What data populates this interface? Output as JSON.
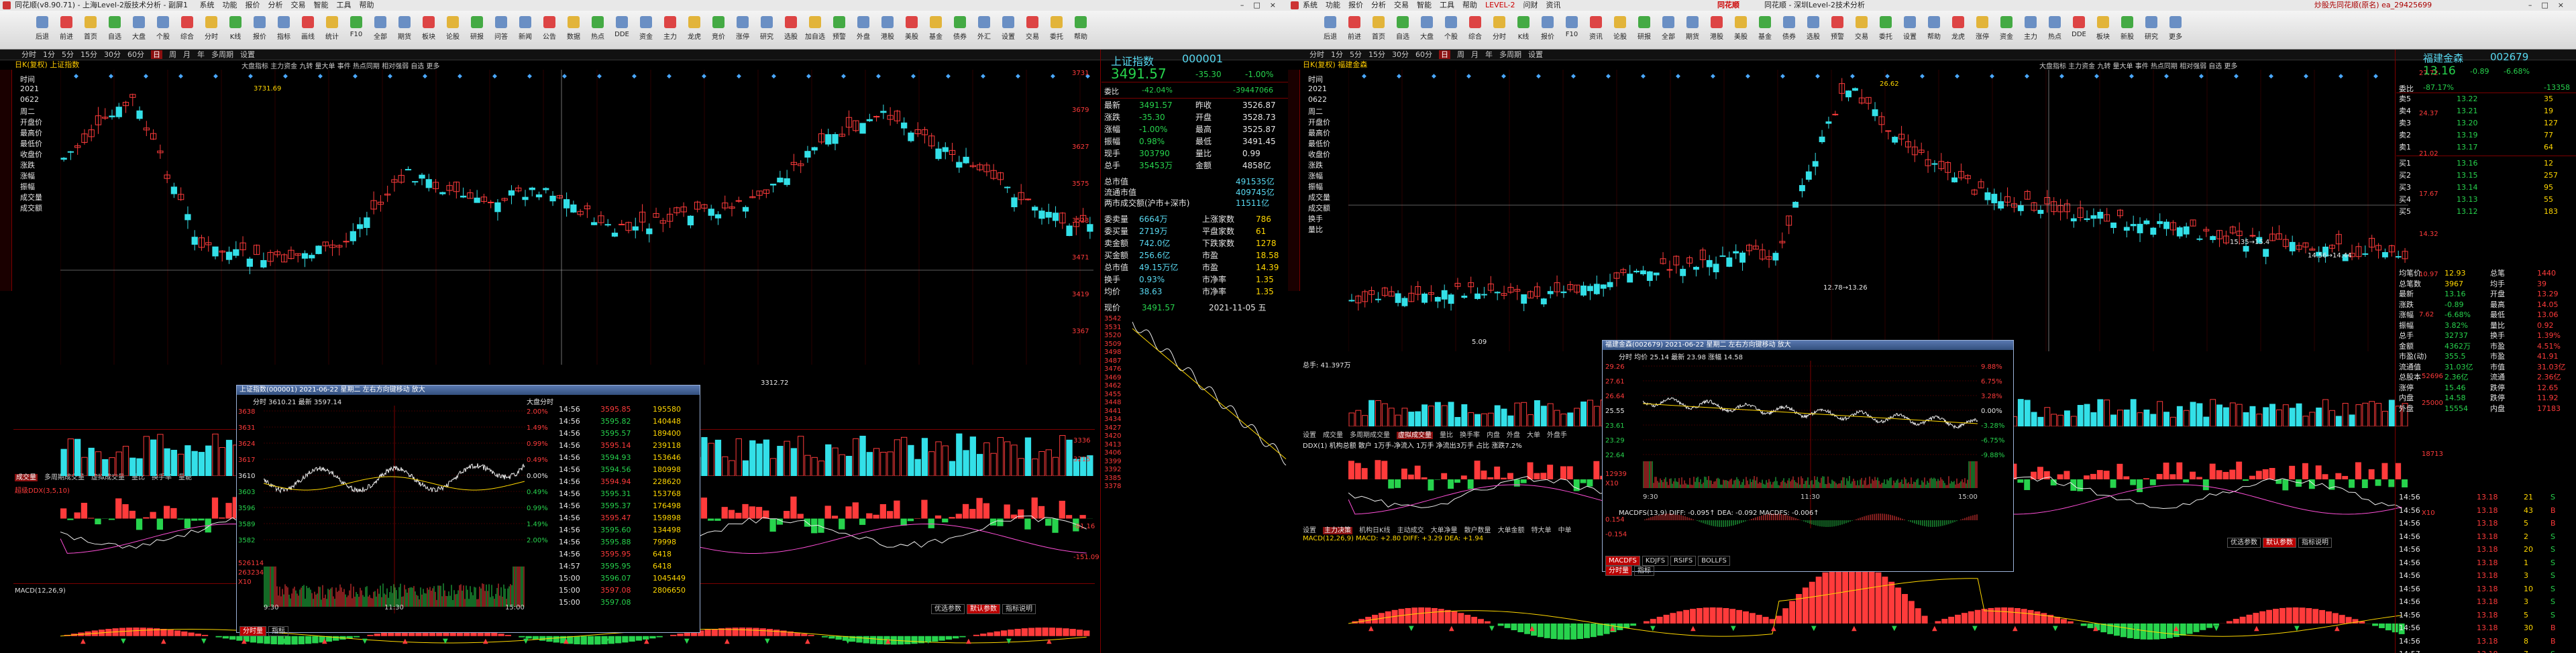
{
  "left_window": {
    "title": "同花顺(v8.90.71) - 上海Level-2版技术分析 - 副屏1",
    "menu": [
      "系统",
      "功能",
      "报价",
      "分析",
      "交易",
      "智能",
      "工具",
      "帮助"
    ],
    "toolbar": [
      "后退",
      "前进",
      "首页",
      "自选",
      "大盘",
      "个股",
      "综合",
      "分时",
      "K线",
      "报价",
      "指标",
      "画线",
      "统计",
      "F10",
      "全部",
      "期货",
      "板块",
      "论股",
      "研报",
      "问答",
      "新闻",
      "公告",
      "数据",
      "热点",
      "DDE",
      "资金",
      "主力",
      "龙虎",
      "竞价",
      "涨停",
      "研究",
      "选股",
      "加自选",
      "预警",
      "外盘",
      "港股",
      "美股",
      "基金",
      "债券",
      "外汇",
      "设置",
      "交易",
      "委托",
      "帮助"
    ],
    "period_tabs": [
      "分时",
      "1分",
      "5分",
      "15分",
      "30分",
      "60分",
      "日",
      "周",
      "月",
      "年",
      "多周期",
      "设置"
    ],
    "active_period": "日",
    "stock_header": "日K(复权) 上证指数",
    "side_labels": [
      "时间",
      "2021",
      "0622",
      "周二",
      "开盘价",
      "最高价",
      "最低价",
      "收盘价",
      "涨跌",
      "涨幅",
      "振幅",
      "成交量",
      "成交额"
    ],
    "price_axis": [
      "3731",
      "3679",
      "3627",
      "3575",
      "3523",
      "3471",
      "3419",
      "3367"
    ],
    "annotations": {
      "high": "3731.69",
      "low": "3312.72"
    },
    "indicator_tabs": [
      "成交量",
      "多周期成交量",
      "虚拟成交量",
      "量比",
      "换手率",
      "量能"
    ],
    "vol_axis": [
      "3336",
      "3215",
      "3094"
    ],
    "macd_label": "MACD(12,26,9)",
    "ddx_label": "超级DDX(3,5,10)",
    "ddx_axis": [
      "-81.16",
      "-151.09"
    ],
    "bottom_tabs": [
      "主力追踪",
      "大单追踪",
      "资金流",
      "主动买入",
      "指标说明"
    ],
    "bottom_buttons": [
      "优选参数",
      "默认参数",
      "指标说明"
    ],
    "legend_box": "大盘指标 主力资金 九转 量大单 事件 热点同期 相对强弱 自选 更多",
    "quote": {
      "name": "上证指数",
      "code": "000001",
      "price": "3491.57",
      "change": "-35.30",
      "pct": "-1.00%",
      "weibi_label": "委比",
      "weibi": "-42.04%",
      "weicha": "-39447066",
      "rows": [
        {
          "l": "最新",
          "v": "3491.57",
          "l2": "昨收",
          "v2": "3526.87"
        },
        {
          "l": "涨跌",
          "v": "-35.30",
          "l2": "开盘",
          "v2": "3528.73"
        },
        {
          "l": "涨幅",
          "v": "-1.00%",
          "l2": "最高",
          "v2": "3525.87"
        },
        {
          "l": "振幅",
          "v": "0.98%",
          "l2": "最低",
          "v2": "3491.45"
        },
        {
          "l": "现手",
          "v": "303790",
          "l2": "量比",
          "v2": "0.99"
        },
        {
          "l": "总手",
          "v": "35453万",
          "l2": "金额",
          "v2": "4858亿"
        }
      ],
      "rows2": [
        {
          "l": "总市值",
          "v": "491535亿"
        },
        {
          "l": "流通市值",
          "v": "409745亿"
        },
        {
          "l": "两市成交额(沪市+深市)",
          "v": "11511亿"
        }
      ],
      "rows3": [
        {
          "l": "委卖量",
          "v": "6664万",
          "l2": "上涨家数",
          "v2": "786"
        },
        {
          "l": "委买量",
          "v": "2719万",
          "l2": "平盘家数",
          "v2": "61"
        },
        {
          "l": "卖金额",
          "v": "742.0亿",
          "l2": "下跌家数",
          "v2": "1278"
        },
        {
          "l": "买金额",
          "v": "256.6亿",
          "l2": "市盈",
          "v2": "18.58"
        },
        {
          "l": "总市值",
          "v": "49.15万亿",
          "l2": "市盈",
          "v2": "14.39"
        },
        {
          "l": "换手",
          "v": "0.93%",
          "l2": "市净率",
          "v2": "1.35"
        },
        {
          "l": "均价",
          "v": "38.63",
          "l2": "市净率",
          "v2": "1.35"
        }
      ],
      "footer_l": "现价",
      "footer_price": "3491.57",
      "footer_date": "2021-11-05 五",
      "mini_axis": [
        "3542",
        "3531",
        "3520",
        "3509",
        "3498",
        "3487",
        "3476",
        "3469",
        "3462",
        "3455",
        "3448",
        "3441",
        "3434",
        "3427",
        "3420",
        "3413",
        "3406",
        "3399",
        "3392",
        "3385",
        "3378"
      ]
    },
    "popup": {
      "title": "上证指数(000001) 2021-06-22 星期二  左右方向键移动 放大",
      "subtitle": "分时 3610.21 最新 3597.14",
      "stat": "大盘分时",
      "yaxis_l": [
        "3638",
        "3631",
        "3624",
        "3617",
        "3610",
        "3603",
        "3596",
        "3589",
        "3582"
      ],
      "yaxis_r": [
        "2.00%",
        "1.49%",
        "0.99%",
        "0.49%",
        "0.00%",
        "0.49%",
        "0.99%",
        "1.49%",
        "2.00%"
      ],
      "vol_axis": [
        "526114",
        "263234",
        "X10"
      ],
      "times": [
        "9:30",
        "11:30",
        "15:00"
      ],
      "ticks": [
        {
          "t": "14:56",
          "p": "3595.85",
          "v": "195580"
        },
        {
          "t": "14:56",
          "p": "3595.82",
          "v": "140448"
        },
        {
          "t": "14:56",
          "p": "3595.57",
          "v": "189400"
        },
        {
          "t": "14:56",
          "p": "3595.14",
          "v": "239118"
        },
        {
          "t": "14:56",
          "p": "3594.93",
          "v": "153646"
        },
        {
          "t": "14:56",
          "p": "3594.56",
          "v": "180998"
        },
        {
          "t": "14:56",
          "p": "3594.94",
          "v": "228620"
        },
        {
          "t": "14:56",
          "p": "3595.31",
          "v": "153768"
        },
        {
          "t": "14:56",
          "p": "3595.37",
          "v": "176498"
        },
        {
          "t": "14:56",
          "p": "3595.47",
          "v": "159898"
        },
        {
          "t": "14:56",
          "p": "3595.60",
          "v": "134498"
        },
        {
          "t": "14:56",
          "p": "3595.88",
          "v": "79998"
        },
        {
          "t": "14:56",
          "p": "3595.95",
          "v": "6418"
        },
        {
          "t": "14:57",
          "p": "3595.95",
          "v": "6418"
        },
        {
          "t": "15:00",
          "p": "3596.07",
          "v": "1045449"
        },
        {
          "t": "15:00",
          "p": "3597.08",
          "v": "2806650"
        },
        {
          "t": "15:00",
          "p": "3597.08",
          "v": ""
        }
      ],
      "tabs": [
        "分时量",
        "指标"
      ]
    }
  },
  "right_window": {
    "title": "同花顺 - 深圳Level-2技术分析",
    "menu": [
      "系统",
      "功能",
      "报价",
      "分析",
      "交易",
      "智能",
      "工具",
      "帮助",
      "LEVEL-2",
      "问财",
      "资讯"
    ],
    "brand": "同花顺",
    "account": "炒股先同花顺(原名) ea_29425699",
    "toolbar": [
      "后退",
      "前进",
      "首页",
      "自选",
      "大盘",
      "个股",
      "综合",
      "分时",
      "K线",
      "报价",
      "F10",
      "资讯",
      "论股",
      "研报",
      "全部",
      "期货",
      "港股",
      "美股",
      "基金",
      "债券",
      "选股",
      "预警",
      "交易",
      "委托",
      "设置",
      "帮助",
      "龙虎",
      "涨停",
      "资金",
      "主力",
      "热点",
      "DDE",
      "板块",
      "新股",
      "研究",
      "更多"
    ],
    "period_tabs": [
      "分时",
      "1分",
      "5分",
      "15分",
      "30分",
      "60分",
      "日",
      "周",
      "月",
      "年",
      "多周期",
      "设置"
    ],
    "stock_header": "日K(复权) 福建金森",
    "legend": "大盘指标 主力资金 九转 量大单 事件 热点同期 相对强弱 自选 更多",
    "side_labels": [
      "时间",
      "2021",
      "0622",
      "周二",
      "开盘价",
      "最高价",
      "最低价",
      "收盘价",
      "涨跌",
      "涨幅",
      "振幅",
      "成交量",
      "成交额",
      "换手",
      "量比"
    ],
    "annotations": {
      "high": "26.62",
      "low": "5.09",
      "a1": "12.78→13.26",
      "a2": "15.35→15.4",
      "a3": "14.56→14.44"
    },
    "price_axis": [
      "27.72",
      "24.37",
      "21.02",
      "17.67",
      "14.32",
      "10.97",
      "7.62"
    ],
    "vol_label": "总手: 41.397万",
    "vol_axis": [
      "52696",
      "25000"
    ],
    "indicator_tabs": [
      "设置",
      "成交量",
      "多周期成交量",
      "虚拟成交量",
      "量比",
      "换手率",
      "内盘",
      "外盘",
      "大单",
      "外盘手"
    ],
    "indicator_line": "DDX(1) 机构总额 散户 1万手-净流入 1万手 净流出3万手 占比 涨跌7.2%",
    "macd_tabs": [
      "设置",
      "主力决策",
      "机构日K线",
      "主动成交",
      "大单净量",
      "散户数量",
      "大单金额",
      "特大单",
      "中单"
    ],
    "macd_label": "MACD(12,26,9)  MACD: +2.80  DIFF: +3.29  DEA: +1.94",
    "macd_axis": [
      "18713",
      "X10"
    ],
    "bottom_buttons": [
      "优选参数",
      "默认参数",
      "指标说明"
    ],
    "quote": {
      "name": "福建金森",
      "code": "002679",
      "price": "13.16",
      "change": "-0.89",
      "pct": "-6.68%",
      "weibi_label": "委比",
      "weibi": "-87.17%",
      "weicha": "-13358",
      "sell": [
        {
          "l": "卖5",
          "p": "13.22",
          "v": "35"
        },
        {
          "l": "卖4",
          "p": "13.21",
          "v": "19"
        },
        {
          "l": "卖3",
          "p": "13.20",
          "v": "127"
        },
        {
          "l": "卖2",
          "p": "13.19",
          "v": "77"
        },
        {
          "l": "卖1",
          "p": "13.17",
          "v": "64"
        }
      ],
      "buy": [
        {
          "l": "买1",
          "p": "13.16",
          "v": "12"
        },
        {
          "l": "买2",
          "p": "13.15",
          "v": "257"
        },
        {
          "l": "买3",
          "p": "13.14",
          "v": "95"
        },
        {
          "l": "买4",
          "p": "13.13",
          "v": "55"
        },
        {
          "l": "买5",
          "p": "13.12",
          "v": "183"
        }
      ],
      "stats": [
        {
          "l": "均笔价",
          "v": "12.93",
          "l2": "总笔",
          "v2": "1440"
        },
        {
          "l": "总笔数",
          "v": "3967",
          "l2": "均手",
          "v2": "39"
        },
        {
          "l": "最新",
          "v": "13.16",
          "l2": "开盘",
          "v2": "13.29"
        },
        {
          "l": "涨跌",
          "v": "-0.89",
          "l2": "最高",
          "v2": "14.05"
        },
        {
          "l": "涨幅",
          "v": "-6.68%",
          "l2": "最低",
          "v2": "13.06"
        },
        {
          "l": "振幅",
          "v": "3.82%",
          "l2": "量比",
          "v2": "0.92"
        },
        {
          "l": "总手",
          "v": "32737",
          "l2": "换手",
          "v2": "1.39%"
        },
        {
          "l": "金额",
          "v": "4362万",
          "l2": "市盈",
          "v2": "4.51%"
        },
        {
          "l": "市盈(动)",
          "v": "355.5",
          "l2": "市盈",
          "v2": "41.91"
        },
        {
          "l": "流通值",
          "v": "31.03亿",
          "l2": "市值",
          "v2": "31.03亿"
        },
        {
          "l": "总股本",
          "v": "2.36亿",
          "l2": "流通",
          "v2": "2.36亿"
        },
        {
          "l": "涨停",
          "v": "15.46",
          "l2": "跌停",
          "v2": "12.65"
        },
        {
          "l": "内盘",
          "v": "14.58",
          "l2": "跌停",
          "v2": "11.92"
        },
        {
          "l": "外盘",
          "v": "15554",
          "l2": "内盘",
          "v2": "17183"
        }
      ],
      "ticks": [
        {
          "t": "14:56",
          "p": "13.18",
          "v": "21",
          "d": "S"
        },
        {
          "t": "14:56",
          "p": "13.18",
          "v": "43",
          "d": "B"
        },
        {
          "t": "14:56",
          "p": "13.18",
          "v": "5",
          "d": "B"
        },
        {
          "t": "14:56",
          "p": "13.18",
          "v": "2",
          "d": "S"
        },
        {
          "t": "14:56",
          "p": "13.18",
          "v": "20",
          "d": "S"
        },
        {
          "t": "14:56",
          "p": "13.18",
          "v": "1",
          "d": "S"
        },
        {
          "t": "14:56",
          "p": "13.18",
          "v": "3",
          "d": "S"
        },
        {
          "t": "14:56",
          "p": "13.18",
          "v": "10",
          "d": "S"
        },
        {
          "t": "14:56",
          "p": "13.18",
          "v": "3",
          "d": "S"
        },
        {
          "t": "14:56",
          "p": "13.18",
          "v": "5",
          "d": "S"
        },
        {
          "t": "14:56",
          "p": "13.18",
          "v": "30",
          "d": "B"
        },
        {
          "t": "14:56",
          "p": "13.18",
          "v": "8",
          "d": "B"
        },
        {
          "t": "14:57",
          "p": "13.18",
          "v": "7",
          "d": "S"
        },
        {
          "t": "15:00",
          "p": "13.16",
          "v": "51",
          "d": "S"
        },
        {
          "t": "15:00",
          "p": "13.16",
          "v": "30",
          "d": "S"
        }
      ]
    },
    "popup": {
      "title": "福建金森(002679) 2021-06-22 星期二  左右方向键移动 放大",
      "subtitle": "分时 均价 25.14 最新 23.98 涨幅 14.58",
      "yaxis_l": [
        "29.26",
        "27.61",
        "26.64",
        "25.55",
        "23.61",
        "23.29",
        "22.64"
      ],
      "yaxis_r": [
        "9.88%",
        "6.75%",
        "3.28%",
        "0.00%",
        "-3.28%",
        "-6.75%",
        "-9.88%"
      ],
      "vol_axis": [
        "12939",
        "X10"
      ],
      "times": [
        "9:30",
        "11:30",
        "15:00"
      ],
      "macd": "MACDFS(13,9) DIFF: -0.095↑ DEA: -0.092 MACDFS: -0.006↑",
      "macd_axis": [
        "0.154",
        "-0.154"
      ],
      "tabs": [
        "MACDFS",
        "KDJFS",
        "RSIFS",
        "BOLLFS"
      ],
      "bottom_tabs": [
        "分时量",
        "指标"
      ]
    }
  }
}
